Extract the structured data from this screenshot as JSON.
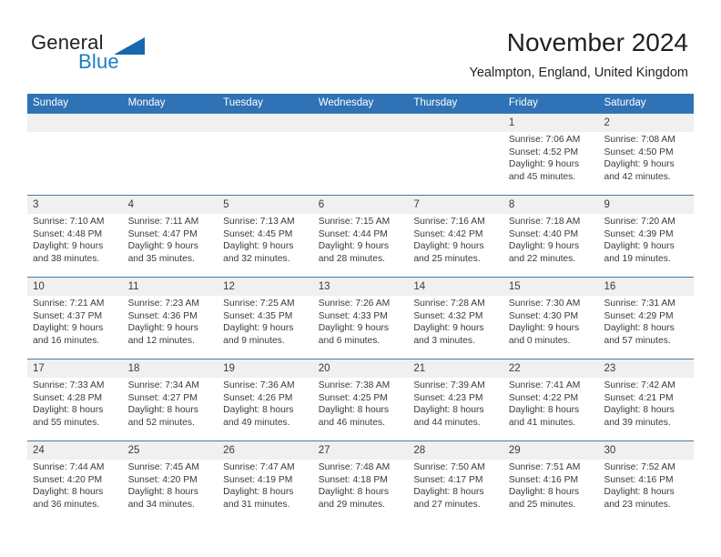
{
  "brand": {
    "name_dark": "General",
    "name_blue": "Blue",
    "accent_color": "#1667ad",
    "blue_text_color": "#1a7fc1"
  },
  "header": {
    "title": "November 2024",
    "subtitle": "Yealmpton, England, United Kingdom"
  },
  "calendar": {
    "header_bg": "#2f72b5",
    "number_band_bg": "#f0f0f0",
    "day_names": [
      "Sunday",
      "Monday",
      "Tuesday",
      "Wednesday",
      "Thursday",
      "Friday",
      "Saturday"
    ],
    "weeks": [
      [
        {
          "day": "",
          "empty": true
        },
        {
          "day": "",
          "empty": true
        },
        {
          "day": "",
          "empty": true
        },
        {
          "day": "",
          "empty": true
        },
        {
          "day": "",
          "empty": true
        },
        {
          "day": "1",
          "sunrise": "Sunrise: 7:06 AM",
          "sunset": "Sunset: 4:52 PM",
          "daylight": "Daylight: 9 hours and 45 minutes."
        },
        {
          "day": "2",
          "sunrise": "Sunrise: 7:08 AM",
          "sunset": "Sunset: 4:50 PM",
          "daylight": "Daylight: 9 hours and 42 minutes."
        }
      ],
      [
        {
          "day": "3",
          "sunrise": "Sunrise: 7:10 AM",
          "sunset": "Sunset: 4:48 PM",
          "daylight": "Daylight: 9 hours and 38 minutes."
        },
        {
          "day": "4",
          "sunrise": "Sunrise: 7:11 AM",
          "sunset": "Sunset: 4:47 PM",
          "daylight": "Daylight: 9 hours and 35 minutes."
        },
        {
          "day": "5",
          "sunrise": "Sunrise: 7:13 AM",
          "sunset": "Sunset: 4:45 PM",
          "daylight": "Daylight: 9 hours and 32 minutes."
        },
        {
          "day": "6",
          "sunrise": "Sunrise: 7:15 AM",
          "sunset": "Sunset: 4:44 PM",
          "daylight": "Daylight: 9 hours and 28 minutes."
        },
        {
          "day": "7",
          "sunrise": "Sunrise: 7:16 AM",
          "sunset": "Sunset: 4:42 PM",
          "daylight": "Daylight: 9 hours and 25 minutes."
        },
        {
          "day": "8",
          "sunrise": "Sunrise: 7:18 AM",
          "sunset": "Sunset: 4:40 PM",
          "daylight": "Daylight: 9 hours and 22 minutes."
        },
        {
          "day": "9",
          "sunrise": "Sunrise: 7:20 AM",
          "sunset": "Sunset: 4:39 PM",
          "daylight": "Daylight: 9 hours and 19 minutes."
        }
      ],
      [
        {
          "day": "10",
          "sunrise": "Sunrise: 7:21 AM",
          "sunset": "Sunset: 4:37 PM",
          "daylight": "Daylight: 9 hours and 16 minutes."
        },
        {
          "day": "11",
          "sunrise": "Sunrise: 7:23 AM",
          "sunset": "Sunset: 4:36 PM",
          "daylight": "Daylight: 9 hours and 12 minutes."
        },
        {
          "day": "12",
          "sunrise": "Sunrise: 7:25 AM",
          "sunset": "Sunset: 4:35 PM",
          "daylight": "Daylight: 9 hours and 9 minutes."
        },
        {
          "day": "13",
          "sunrise": "Sunrise: 7:26 AM",
          "sunset": "Sunset: 4:33 PM",
          "daylight": "Daylight: 9 hours and 6 minutes."
        },
        {
          "day": "14",
          "sunrise": "Sunrise: 7:28 AM",
          "sunset": "Sunset: 4:32 PM",
          "daylight": "Daylight: 9 hours and 3 minutes."
        },
        {
          "day": "15",
          "sunrise": "Sunrise: 7:30 AM",
          "sunset": "Sunset: 4:30 PM",
          "daylight": "Daylight: 9 hours and 0 minutes."
        },
        {
          "day": "16",
          "sunrise": "Sunrise: 7:31 AM",
          "sunset": "Sunset: 4:29 PM",
          "daylight": "Daylight: 8 hours and 57 minutes."
        }
      ],
      [
        {
          "day": "17",
          "sunrise": "Sunrise: 7:33 AM",
          "sunset": "Sunset: 4:28 PM",
          "daylight": "Daylight: 8 hours and 55 minutes."
        },
        {
          "day": "18",
          "sunrise": "Sunrise: 7:34 AM",
          "sunset": "Sunset: 4:27 PM",
          "daylight": "Daylight: 8 hours and 52 minutes."
        },
        {
          "day": "19",
          "sunrise": "Sunrise: 7:36 AM",
          "sunset": "Sunset: 4:26 PM",
          "daylight": "Daylight: 8 hours and 49 minutes."
        },
        {
          "day": "20",
          "sunrise": "Sunrise: 7:38 AM",
          "sunset": "Sunset: 4:25 PM",
          "daylight": "Daylight: 8 hours and 46 minutes."
        },
        {
          "day": "21",
          "sunrise": "Sunrise: 7:39 AM",
          "sunset": "Sunset: 4:23 PM",
          "daylight": "Daylight: 8 hours and 44 minutes."
        },
        {
          "day": "22",
          "sunrise": "Sunrise: 7:41 AM",
          "sunset": "Sunset: 4:22 PM",
          "daylight": "Daylight: 8 hours and 41 minutes."
        },
        {
          "day": "23",
          "sunrise": "Sunrise: 7:42 AM",
          "sunset": "Sunset: 4:21 PM",
          "daylight": "Daylight: 8 hours and 39 minutes."
        }
      ],
      [
        {
          "day": "24",
          "sunrise": "Sunrise: 7:44 AM",
          "sunset": "Sunset: 4:20 PM",
          "daylight": "Daylight: 8 hours and 36 minutes."
        },
        {
          "day": "25",
          "sunrise": "Sunrise: 7:45 AM",
          "sunset": "Sunset: 4:20 PM",
          "daylight": "Daylight: 8 hours and 34 minutes."
        },
        {
          "day": "26",
          "sunrise": "Sunrise: 7:47 AM",
          "sunset": "Sunset: 4:19 PM",
          "daylight": "Daylight: 8 hours and 31 minutes."
        },
        {
          "day": "27",
          "sunrise": "Sunrise: 7:48 AM",
          "sunset": "Sunset: 4:18 PM",
          "daylight": "Daylight: 8 hours and 29 minutes."
        },
        {
          "day": "28",
          "sunrise": "Sunrise: 7:50 AM",
          "sunset": "Sunset: 4:17 PM",
          "daylight": "Daylight: 8 hours and 27 minutes."
        },
        {
          "day": "29",
          "sunrise": "Sunrise: 7:51 AM",
          "sunset": "Sunset: 4:16 PM",
          "daylight": "Daylight: 8 hours and 25 minutes."
        },
        {
          "day": "30",
          "sunrise": "Sunrise: 7:52 AM",
          "sunset": "Sunset: 4:16 PM",
          "daylight": "Daylight: 8 hours and 23 minutes."
        }
      ]
    ]
  }
}
